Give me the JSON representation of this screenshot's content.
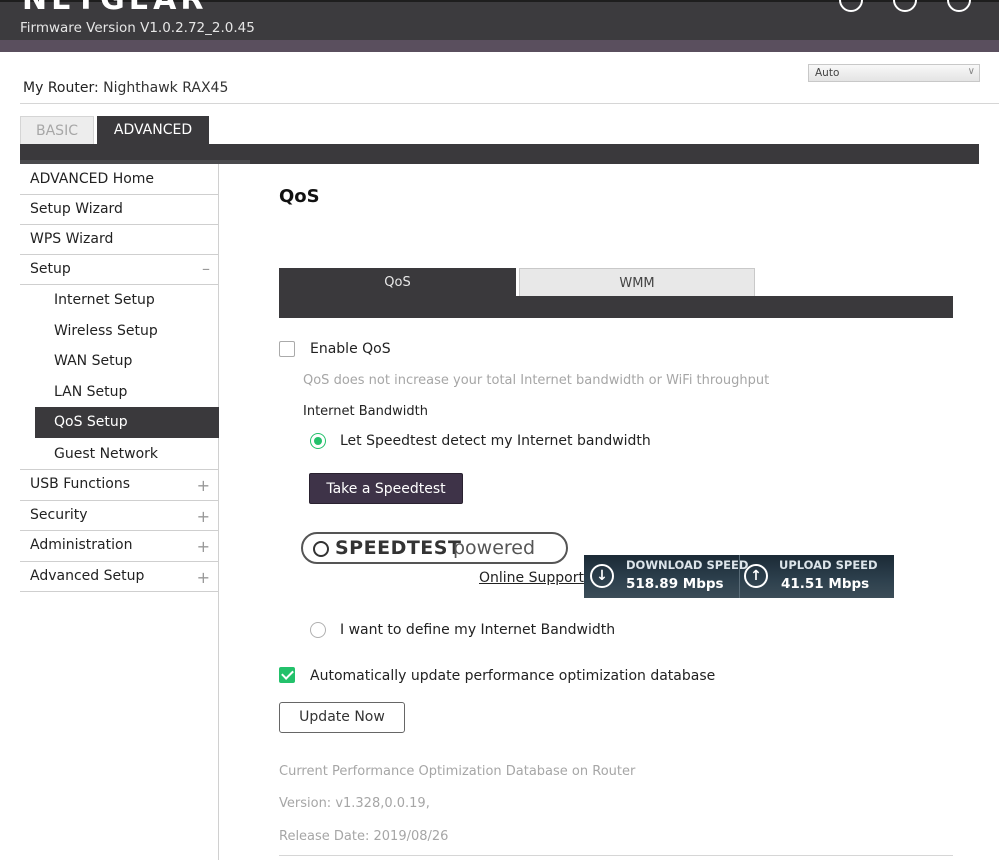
{
  "header": {
    "logo_text": "NETGEAR",
    "firmware": "Firmware Version V1.0.2.72_2.0.45",
    "icons": [
      "help-icon",
      "account-icon",
      "power-icon"
    ]
  },
  "router": {
    "label": "My Router:",
    "name": "Nighthawk RAX45"
  },
  "language_select": {
    "value": "Auto"
  },
  "main_tabs": [
    {
      "label": "BASIC",
      "active": false
    },
    {
      "label": "ADVANCED",
      "active": true
    }
  ],
  "sidebar": {
    "items": [
      {
        "label": "ADVANCED Home"
      },
      {
        "label": "Setup Wizard"
      },
      {
        "label": "WPS Wizard"
      },
      {
        "label": "Setup",
        "sign": "–"
      },
      {
        "label": "Internet Setup"
      },
      {
        "label": "Wireless Setup"
      },
      {
        "label": "WAN Setup"
      },
      {
        "label": "LAN Setup"
      },
      {
        "label": "QoS Setup"
      },
      {
        "label": "Guest Network"
      },
      {
        "label": "USB Functions",
        "sign": "+"
      },
      {
        "label": "Security",
        "sign": "+"
      },
      {
        "label": "Administration",
        "sign": "+"
      },
      {
        "label": "Advanced Setup",
        "sign": "+"
      }
    ]
  },
  "content": {
    "title": "QoS",
    "subtabs": [
      {
        "label": "QoS",
        "active": true
      },
      {
        "label": "WMM",
        "active": false
      }
    ],
    "enable_qos": {
      "label": "Enable QoS",
      "checked": false
    },
    "qos_note": "QoS does not increase your total Internet bandwidth or WiFi throughput",
    "bandwidth_heading": "Internet Bandwidth",
    "radio_speedtest": {
      "label": "Let Speedtest detect my Internet bandwidth",
      "selected": true
    },
    "speedtest_button": "Take a Speedtest",
    "speedtest_logo": {
      "main": "SPEEDTEST",
      "powered": "powered"
    },
    "online_support": "Online Support",
    "download": {
      "label": "DOWNLOAD SPEED",
      "value": "518.89 Mbps"
    },
    "upload": {
      "label": "UPLOAD SPEED",
      "value": "41.51 Mbps"
    },
    "radio_manual": {
      "label": "I want to define my Internet Bandwidth",
      "selected": false
    },
    "auto_update": {
      "label": "Automatically update performance optimization database",
      "checked": true
    },
    "update_button": "Update Now",
    "db_heading": "Current Performance Optimization Database on Router",
    "db_version": "Version: v1.328,0.0.19,",
    "db_release": "Release Date: 2019/08/26"
  },
  "colors": {
    "header_bg": "#3c3b3e",
    "accent_green": "#23c16b",
    "speedtest_button": "#3e3348"
  }
}
